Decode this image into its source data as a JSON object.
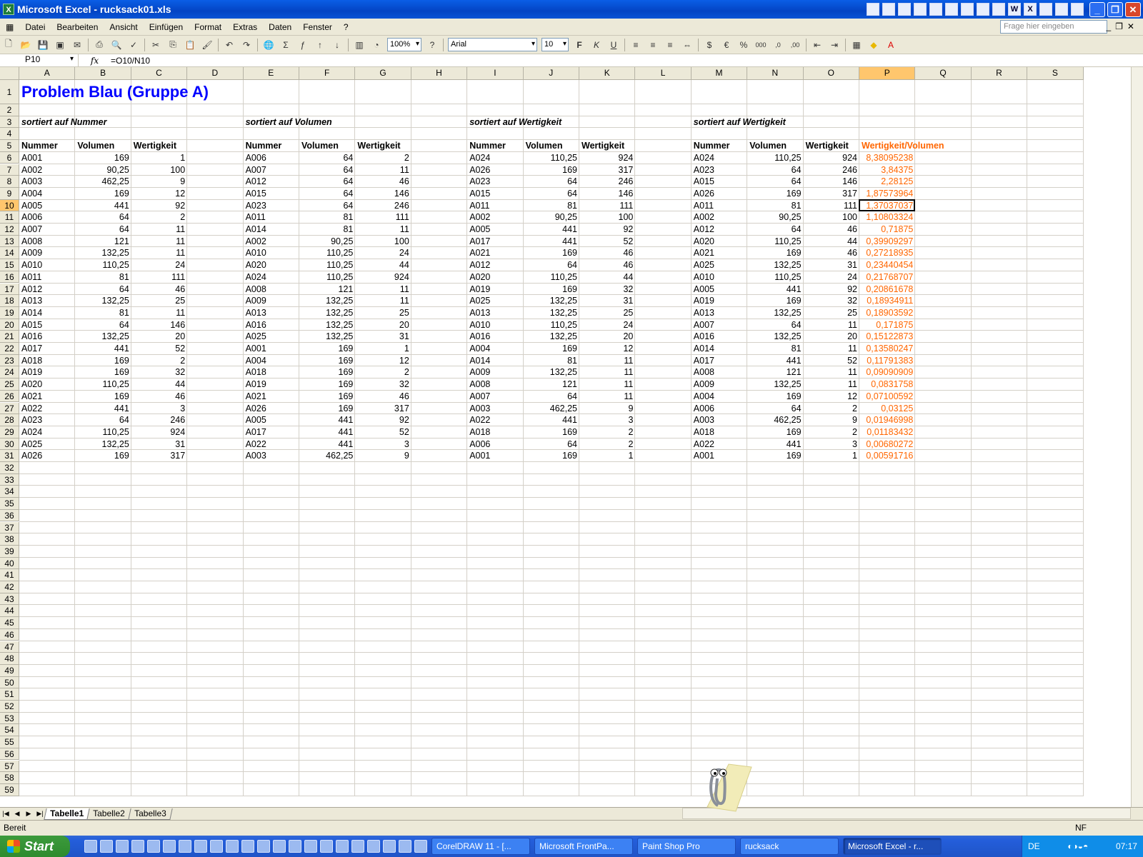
{
  "window": {
    "title": "Microsoft Excel - rucksack01.xls"
  },
  "menu": {
    "items": [
      "Datei",
      "Bearbeiten",
      "Ansicht",
      "Einfügen",
      "Format",
      "Extras",
      "Daten",
      "Fenster",
      "?"
    ],
    "ask_placeholder": "Frage hier eingeben"
  },
  "toolbar": {
    "zoom": "100%",
    "font": "Arial",
    "size": "10"
  },
  "formula": {
    "name_box": "P10",
    "fx": "fx",
    "content": "=O10/N10"
  },
  "columns": [
    "A",
    "B",
    "C",
    "D",
    "E",
    "F",
    "G",
    "H",
    "I",
    "J",
    "K",
    "L",
    "M",
    "N",
    "O",
    "P",
    "Q",
    "R",
    "S"
  ],
  "sheet": {
    "title": "Problem Blau (Gruppe A)",
    "sections": [
      {
        "heading": "sortiert auf Nummer",
        "headers": [
          "Nummer",
          "Volumen",
          "Wertigkeit"
        ],
        "rows": [
          [
            "A001",
            "169",
            "1"
          ],
          [
            "A002",
            "90,25",
            "100"
          ],
          [
            "A003",
            "462,25",
            "9"
          ],
          [
            "A004",
            "169",
            "12"
          ],
          [
            "A005",
            "441",
            "92"
          ],
          [
            "A006",
            "64",
            "2"
          ],
          [
            "A007",
            "64",
            "11"
          ],
          [
            "A008",
            "121",
            "11"
          ],
          [
            "A009",
            "132,25",
            "11"
          ],
          [
            "A010",
            "110,25",
            "24"
          ],
          [
            "A011",
            "81",
            "111"
          ],
          [
            "A012",
            "64",
            "46"
          ],
          [
            "A013",
            "132,25",
            "25"
          ],
          [
            "A014",
            "81",
            "11"
          ],
          [
            "A015",
            "64",
            "146"
          ],
          [
            "A016",
            "132,25",
            "20"
          ],
          [
            "A017",
            "441",
            "52"
          ],
          [
            "A018",
            "169",
            "2"
          ],
          [
            "A019",
            "169",
            "32"
          ],
          [
            "A020",
            "110,25",
            "44"
          ],
          [
            "A021",
            "169",
            "46"
          ],
          [
            "A022",
            "441",
            "3"
          ],
          [
            "A023",
            "64",
            "246"
          ],
          [
            "A024",
            "110,25",
            "924"
          ],
          [
            "A025",
            "132,25",
            "31"
          ],
          [
            "A026",
            "169",
            "317"
          ]
        ]
      },
      {
        "heading": "sortiert auf Volumen",
        "headers": [
          "Nummer",
          "Volumen",
          "Wertigkeit"
        ],
        "rows": [
          [
            "A006",
            "64",
            "2"
          ],
          [
            "A007",
            "64",
            "11"
          ],
          [
            "A012",
            "64",
            "46"
          ],
          [
            "A015",
            "64",
            "146"
          ],
          [
            "A023",
            "64",
            "246"
          ],
          [
            "A011",
            "81",
            "111"
          ],
          [
            "A014",
            "81",
            "11"
          ],
          [
            "A002",
            "90,25",
            "100"
          ],
          [
            "A010",
            "110,25",
            "24"
          ],
          [
            "A020",
            "110,25",
            "44"
          ],
          [
            "A024",
            "110,25",
            "924"
          ],
          [
            "A008",
            "121",
            "11"
          ],
          [
            "A009",
            "132,25",
            "11"
          ],
          [
            "A013",
            "132,25",
            "25"
          ],
          [
            "A016",
            "132,25",
            "20"
          ],
          [
            "A025",
            "132,25",
            "31"
          ],
          [
            "A001",
            "169",
            "1"
          ],
          [
            "A004",
            "169",
            "12"
          ],
          [
            "A018",
            "169",
            "2"
          ],
          [
            "A019",
            "169",
            "32"
          ],
          [
            "A021",
            "169",
            "46"
          ],
          [
            "A026",
            "169",
            "317"
          ],
          [
            "A005",
            "441",
            "92"
          ],
          [
            "A017",
            "441",
            "52"
          ],
          [
            "A022",
            "441",
            "3"
          ],
          [
            "A003",
            "462,25",
            "9"
          ]
        ]
      },
      {
        "heading": "sortiert auf Wertigkeit",
        "headers": [
          "Nummer",
          "Volumen",
          "Wertigkeit"
        ],
        "rows": [
          [
            "A024",
            "110,25",
            "924"
          ],
          [
            "A026",
            "169",
            "317"
          ],
          [
            "A023",
            "64",
            "246"
          ],
          [
            "A015",
            "64",
            "146"
          ],
          [
            "A011",
            "81",
            "111"
          ],
          [
            "A002",
            "90,25",
            "100"
          ],
          [
            "A005",
            "441",
            "92"
          ],
          [
            "A017",
            "441",
            "52"
          ],
          [
            "A021",
            "169",
            "46"
          ],
          [
            "A012",
            "64",
            "46"
          ],
          [
            "A020",
            "110,25",
            "44"
          ],
          [
            "A019",
            "169",
            "32"
          ],
          [
            "A025",
            "132,25",
            "31"
          ],
          [
            "A013",
            "132,25",
            "25"
          ],
          [
            "A010",
            "110,25",
            "24"
          ],
          [
            "A016",
            "132,25",
            "20"
          ],
          [
            "A004",
            "169",
            "12"
          ],
          [
            "A014",
            "81",
            "11"
          ],
          [
            "A009",
            "132,25",
            "11"
          ],
          [
            "A008",
            "121",
            "11"
          ],
          [
            "A007",
            "64",
            "11"
          ],
          [
            "A003",
            "462,25",
            "9"
          ],
          [
            "A022",
            "441",
            "3"
          ],
          [
            "A018",
            "169",
            "2"
          ],
          [
            "A006",
            "64",
            "2"
          ],
          [
            "A001",
            "169",
            "1"
          ]
        ]
      },
      {
        "heading": "sortiert auf Wertigkeit",
        "headers": [
          "Nummer",
          "Volumen",
          "Wertigkeit",
          "Wertigkeit/Volumen"
        ],
        "rows": [
          [
            "A024",
            "110,25",
            "924",
            "8,38095238"
          ],
          [
            "A023",
            "64",
            "246",
            "3,84375"
          ],
          [
            "A015",
            "64",
            "146",
            "2,28125"
          ],
          [
            "A026",
            "169",
            "317",
            "1,87573964"
          ],
          [
            "A011",
            "81",
            "111",
            "1,37037037"
          ],
          [
            "A002",
            "90,25",
            "100",
            "1,10803324"
          ],
          [
            "A012",
            "64",
            "46",
            "0,71875"
          ],
          [
            "A020",
            "110,25",
            "44",
            "0,39909297"
          ],
          [
            "A021",
            "169",
            "46",
            "0,27218935"
          ],
          [
            "A025",
            "132,25",
            "31",
            "0,23440454"
          ],
          [
            "A010",
            "110,25",
            "24",
            "0,21768707"
          ],
          [
            "A005",
            "441",
            "92",
            "0,20861678"
          ],
          [
            "A019",
            "169",
            "32",
            "0,18934911"
          ],
          [
            "A013",
            "132,25",
            "25",
            "0,18903592"
          ],
          [
            "A007",
            "64",
            "11",
            "0,171875"
          ],
          [
            "A016",
            "132,25",
            "20",
            "0,15122873"
          ],
          [
            "A014",
            "81",
            "11",
            "0,13580247"
          ],
          [
            "A017",
            "441",
            "52",
            "0,11791383"
          ],
          [
            "A008",
            "121",
            "11",
            "0,09090909"
          ],
          [
            "A009",
            "132,25",
            "11",
            "0,0831758"
          ],
          [
            "A004",
            "169",
            "12",
            "0,07100592"
          ],
          [
            "A006",
            "64",
            "2",
            "0,03125"
          ],
          [
            "A003",
            "462,25",
            "9",
            "0,01946998"
          ],
          [
            "A018",
            "169",
            "2",
            "0,01183432"
          ],
          [
            "A022",
            "441",
            "3",
            "0,00680272"
          ],
          [
            "A001",
            "169",
            "1",
            "0,00591716"
          ]
        ]
      }
    ]
  },
  "tabs": [
    "Tabelle1",
    "Tabelle2",
    "Tabelle3"
  ],
  "status": {
    "left": "Bereit",
    "right": "NF"
  },
  "taskbar": {
    "start": "Start",
    "tasks": [
      "CorelDRAW 11 - [...",
      "Microsoft FrontPa...",
      "Paint Shop Pro",
      "rucksack",
      "Microsoft Excel - r..."
    ],
    "lang": "DE",
    "time": "07:17"
  },
  "colors": {
    "title_blue": "#0000ff",
    "ratio_orange": "#ff6600",
    "selection_header": "#ffc66d"
  }
}
